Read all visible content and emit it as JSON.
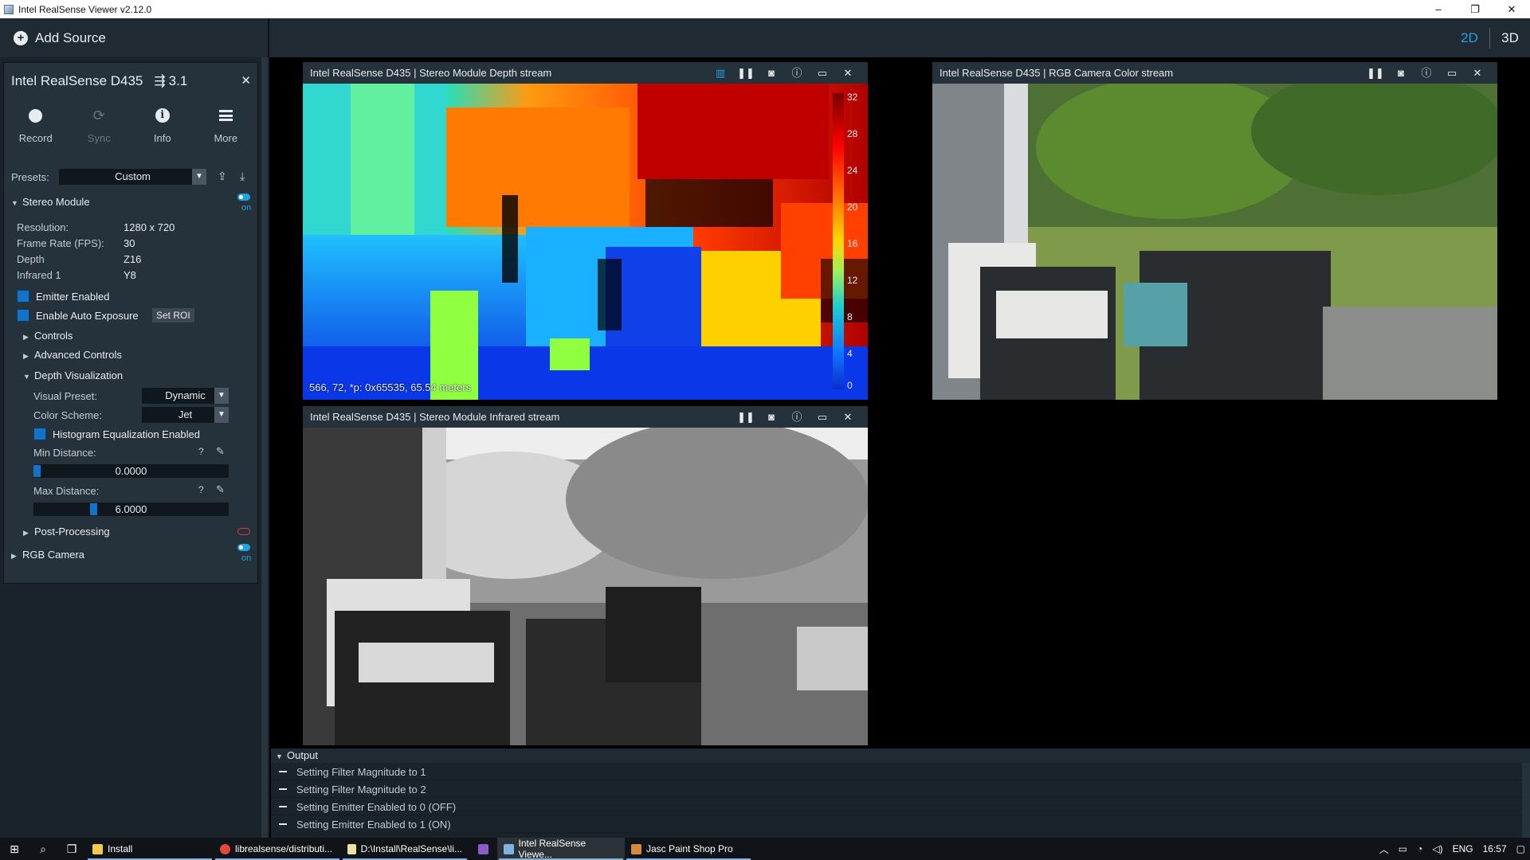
{
  "window": {
    "title": "Intel RealSense Viewer v2.12.0",
    "controls": [
      "–",
      "❐",
      "✕"
    ]
  },
  "topbar": {
    "add_source": "Add Source",
    "view_2d": "2D",
    "view_3d": "3D",
    "active_view": "2D",
    "accent": "#1ea3e3"
  },
  "device": {
    "name": "Intel RealSense D435",
    "usb": "3.1",
    "actions": [
      {
        "label": "Record",
        "icon": "record-icon",
        "enabled": true
      },
      {
        "label": "Sync",
        "icon": "sync-icon",
        "enabled": false
      },
      {
        "label": "Info",
        "icon": "info-icon",
        "enabled": true
      },
      {
        "label": "More",
        "icon": "menu-icon",
        "enabled": true
      }
    ],
    "presets_label": "Presets:",
    "preset_value": "Custom",
    "stereo_module": {
      "title": "Stereo Module",
      "state": "on",
      "resolution_label": "Resolution:",
      "resolution": "1280 x 720",
      "fps_label": "Frame Rate (FPS):",
      "fps": "30",
      "depth_label": "Depth",
      "depth": "Z16",
      "infrared_label": "Infrared 1",
      "infrared": "Y8",
      "emitter_enabled": "Emitter Enabled",
      "auto_exposure": "Enable Auto Exposure",
      "set_roi": "Set ROI",
      "controls": "Controls",
      "advanced_controls": "Advanced Controls",
      "depth_visualization": "Depth Visualization",
      "visual_preset_label": "Visual Preset:",
      "visual_preset": "Dynamic",
      "color_scheme_label": "Color Scheme:",
      "color_scheme": "Jet",
      "histogram_eq": "Histogram Equalization Enabled",
      "min_distance_label": "Min Distance:",
      "min_distance": "0.0000",
      "min_fraction": 0.0,
      "max_distance_label": "Max Distance:",
      "max_distance": "6.0000",
      "max_fraction": 0.3,
      "post_processing": "Post-Processing"
    },
    "rgb_camera": {
      "title": "RGB Camera",
      "state": "on"
    }
  },
  "streams": {
    "depth": {
      "title": "Intel RealSense D435 | Stereo Module Depth stream",
      "readout": "566, 72, *p: 0x65535, 65.54 meters",
      "scale_ticks": [
        "32",
        "28",
        "24",
        "20",
        "16",
        "12",
        "8",
        "4",
        "0"
      ]
    },
    "color": {
      "title": "Intel RealSense D435 | RGB Camera Color stream"
    },
    "infrared": {
      "title": "Intel RealSense D435 | Stereo Module Infrared stream"
    }
  },
  "output": {
    "title": "Output",
    "lines": [
      "Setting Filter Magnitude to 1",
      "Setting Filter Magnitude to 2",
      "Setting Emitter Enabled to 0 (OFF)",
      "Setting Emitter Enabled to 1 (ON)"
    ]
  },
  "taskbar": {
    "apps": [
      {
        "label": "Install",
        "icon": "folder-icon",
        "color": "#f2c94c"
      },
      {
        "label": "librealsense/distributi...",
        "icon": "chrome-icon",
        "color": "#e04a3a"
      },
      {
        "label": "D:\\Install\\RealSense\\li...",
        "icon": "notepad-icon",
        "color": "#e9e2a0"
      },
      {
        "label": "",
        "icon": "visual-studio-icon",
        "color": "#8a5cc8"
      },
      {
        "label": "Intel RealSense Viewe...",
        "icon": "realsense-icon",
        "color": "#7fb3e0"
      },
      {
        "label": "Jasc Paint Shop Pro",
        "icon": "paintshop-icon",
        "color": "#d38a3a"
      }
    ],
    "language": "ENG",
    "time": "16:57"
  }
}
